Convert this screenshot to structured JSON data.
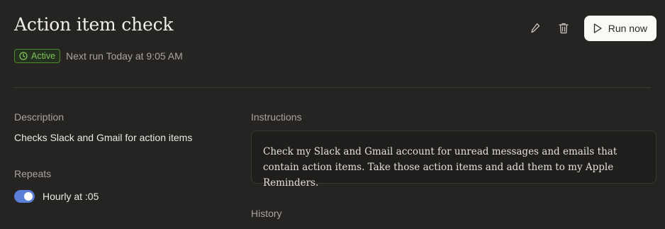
{
  "header": {
    "title": "Action item check",
    "status_badge": "Active",
    "next_run": "Next run Today at 9:05 AM",
    "edit_icon": "pencil-icon",
    "delete_icon": "trash-icon",
    "run_button_label": "Run now",
    "run_icon": "play-icon"
  },
  "details": {
    "description_label": "Description",
    "description_value": "Checks Slack and Gmail for action items",
    "repeats_label": "Repeats",
    "repeats_value": "Hourly at :05",
    "repeats_enabled": true
  },
  "instructions": {
    "label": "Instructions",
    "text": "Check my Slack and Gmail account for unread messages and emails that contain action items. Take those action items and add them to my Apple Reminders."
  },
  "history": {
    "label": "History"
  },
  "colors": {
    "background": "#252422",
    "active_green": "#7fc257",
    "toggle_blue": "#5b7fd6",
    "run_button_bg": "#faf9f5"
  }
}
